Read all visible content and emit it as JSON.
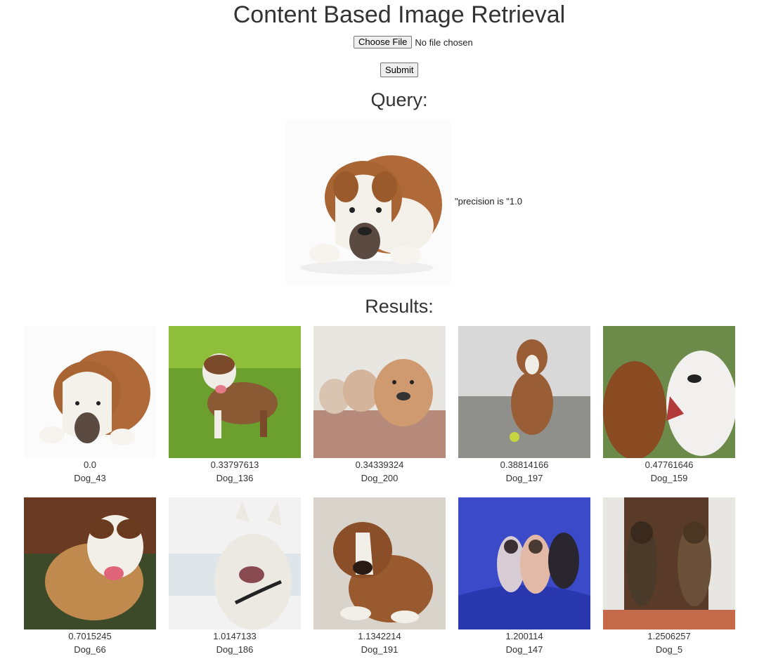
{
  "page": {
    "title": "Content Based Image Retrieval"
  },
  "upload": {
    "choose_label": "Choose File",
    "file_status": "No file chosen",
    "submit_label": "Submit"
  },
  "query": {
    "heading": "Query:",
    "precision_text": "\"precision is \"1.0",
    "image_icon": "bulldog-lying-photo"
  },
  "results": {
    "heading": "Results:",
    "items": [
      {
        "score": "0.0",
        "label": "Dog_43",
        "icon": "bulldog-lying-photo"
      },
      {
        "score": "0.33797613",
        "label": "Dog_136",
        "icon": "bulldog-grass-photo"
      },
      {
        "score": "0.34339324",
        "label": "Dog_200",
        "icon": "bulldog-puppies-photo"
      },
      {
        "score": "0.38814166",
        "label": "Dog_197",
        "icon": "bulldog-sitting-photo"
      },
      {
        "score": "0.47761646",
        "label": "Dog_159",
        "icon": "dogs-playing-photo"
      },
      {
        "score": "0.7015245",
        "label": "Dog_66",
        "icon": "bulldog-standing-photo"
      },
      {
        "score": "1.0147133",
        "label": "Dog_186",
        "icon": "french-bulldog-photo"
      },
      {
        "score": "1.1342214",
        "label": "Dog_191",
        "icon": "boxer-puppy-photo"
      },
      {
        "score": "1.200114",
        "label": "Dog_147",
        "icon": "pug-puppies-photo"
      },
      {
        "score": "1.2506257",
        "label": "Dog_5",
        "icon": "brindle-dogs-photo"
      }
    ]
  }
}
